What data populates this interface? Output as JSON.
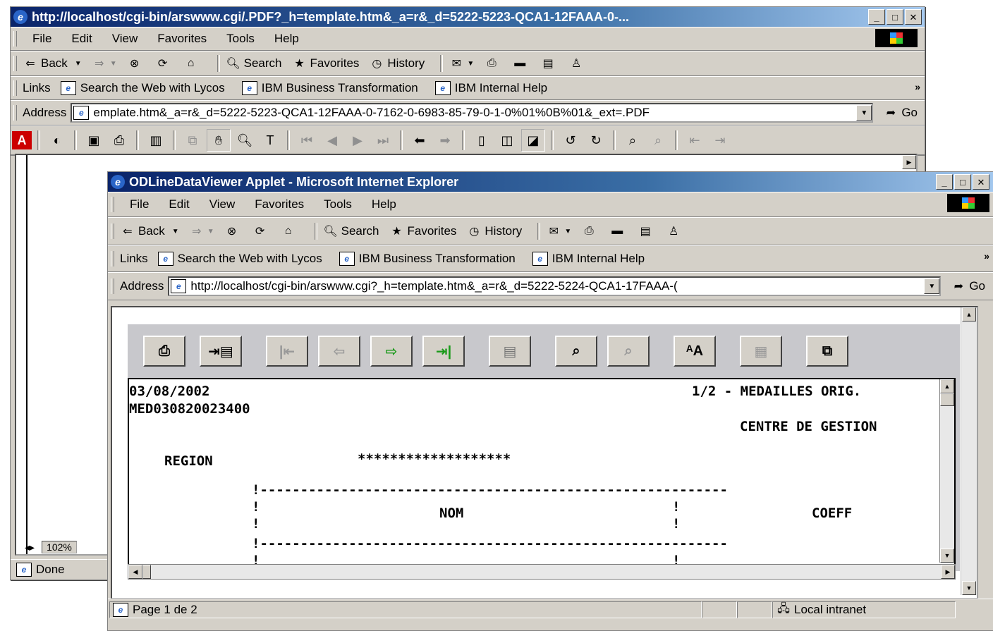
{
  "menu": {
    "file": "File",
    "edit": "Edit",
    "view": "View",
    "favorites": "Favorites",
    "tools": "Tools",
    "help": "Help"
  },
  "toolbar": {
    "back": "Back",
    "search": "Search",
    "favorites": "Favorites",
    "history": "History"
  },
  "links": {
    "label": "Links",
    "items": [
      "Search the Web with Lycos",
      "IBM Business Transformation",
      "IBM Internal Help"
    ]
  },
  "address": {
    "label": "Address",
    "go": "Go"
  },
  "back_window": {
    "title": "http://localhost/cgi-bin/arswww.cgi/.PDF?_h=template.htm&_a=r&_d=5222-5223-QCA1-12FAAA-0-...",
    "address_value": "emplate.htm&_a=r&_d=5222-5223-QCA1-12FAAA-0-7162-0-6983-85-79-0-1-0%01%0B%01&_ext=.PDF",
    "zoom": "102%",
    "status": "Done"
  },
  "front_window": {
    "title": "ODLineDataViewer Applet - Microsoft Internet Explorer",
    "address_value": "http://localhost/cgi-bin/arswww.cgi?_h=template.htm&_a=r&_d=5222-5224-QCA1-17FAAA-(",
    "status": "Page 1 de 2",
    "zone": "Local intranet"
  },
  "report": {
    "date": "03/08/2002",
    "page_header": "1/2 - MEDAILLES ORIG.",
    "report_id": "MED030820023400",
    "centre": "CENTRE DE GESTION",
    "region_label": "REGION",
    "region_value": "*******************",
    "col_nom": "NOM",
    "col_coeff": "COEFF",
    "rule": "!----------------------------------------------------------",
    "bang": "!"
  }
}
